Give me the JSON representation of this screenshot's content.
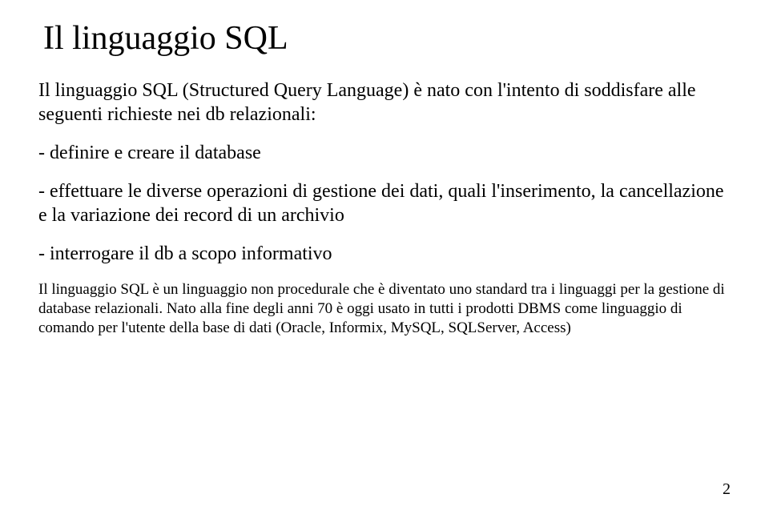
{
  "title": "Il linguaggio SQL",
  "intro": "Il linguaggio SQL (Structured Query Language) è nato con l'intento di soddisfare alle seguenti richieste nei db relazionali:",
  "bullets": [
    "- definire e creare il database",
    "- effettuare le diverse operazioni di gestione dei dati, quali l'inserimento, la cancellazione e la variazione dei record di un archivio",
    "- interrogare il db a scopo informativo"
  ],
  "footer": "Il linguaggio SQL è un linguaggio non procedurale che è diventato uno standard tra i linguaggi per la gestione di database relazionali. Nato alla fine degli anni 70 è oggi usato in tutti i prodotti DBMS come linguaggio di comando per l'utente della base di dati (Oracle, Informix, MySQL, SQLServer, Access)",
  "pageNumber": "2"
}
